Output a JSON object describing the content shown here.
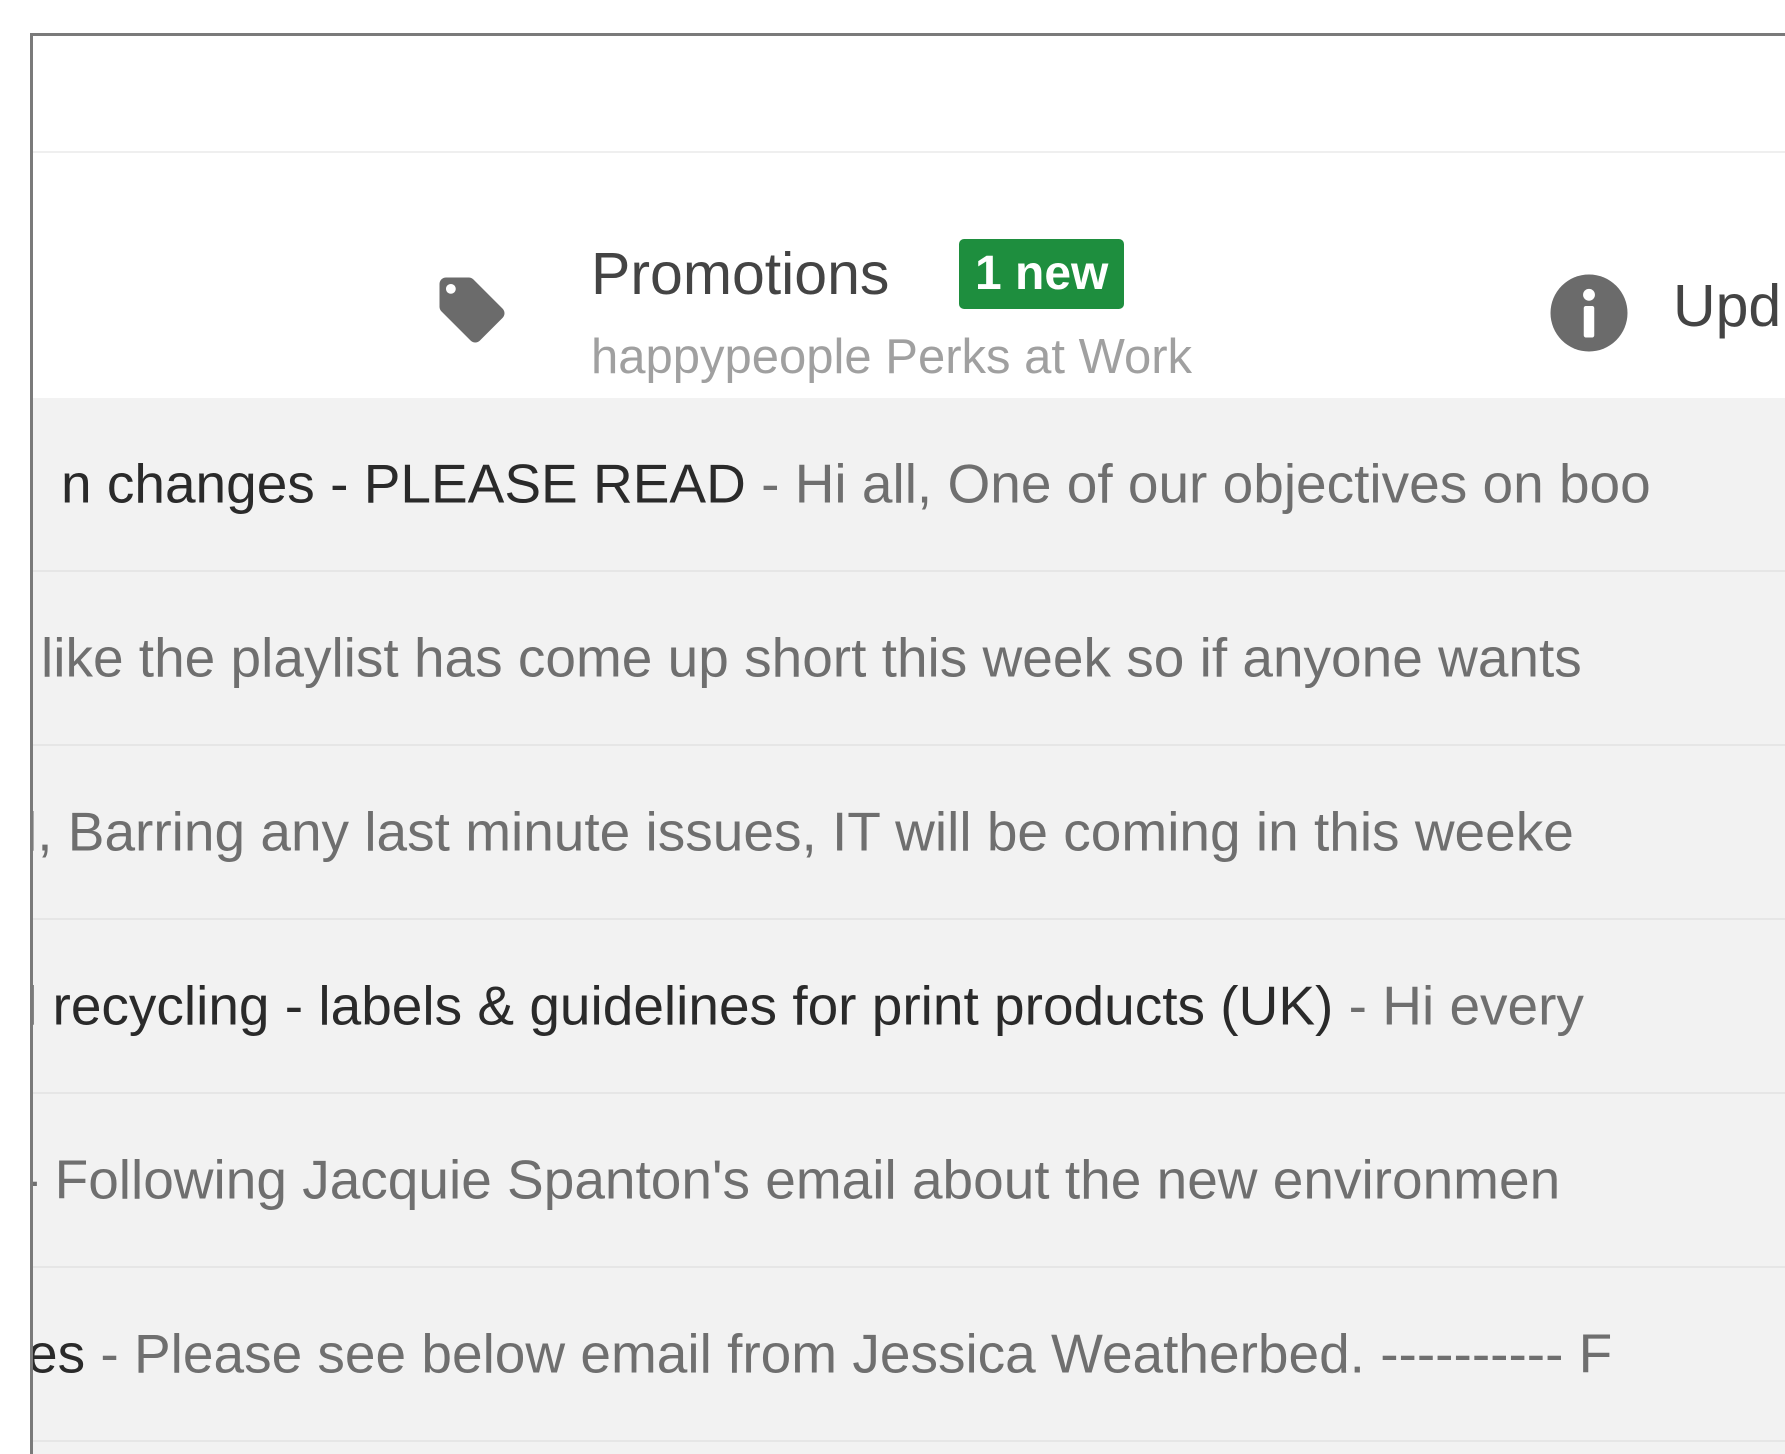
{
  "tabs": {
    "promotions": {
      "icon": "tag-icon",
      "title": "Promotions",
      "badge": "1 new",
      "badge_color": "#1e8e3e",
      "sender": "happypeople Perks at Work"
    },
    "updates": {
      "icon": "info-icon",
      "title": "Upd"
    }
  },
  "emails": [
    {
      "subject": "n changes - PLEASE READ",
      "separator": " - ",
      "snippet": "Hi all, One of our objectives on boo"
    },
    {
      "subject": "",
      "separator": "",
      "snippet": "like the playlist has come up short this week so if anyone wants"
    },
    {
      "subject": "",
      "separator": "",
      "snippet": "l, Barring any last minute issues, IT will be coming in this weeke"
    },
    {
      "subject": "l recycling - labels & guidelines for print products (UK)",
      "separator": " - ",
      "snippet": "Hi every"
    },
    {
      "subject": "",
      "separator": "",
      "snippet": "- Following Jacquie Spanton's email about the new environmen"
    },
    {
      "subject": "es",
      "separator": " - ",
      "snippet": "Please see below email from Jessica Weatherbed. ---------- F"
    }
  ]
}
